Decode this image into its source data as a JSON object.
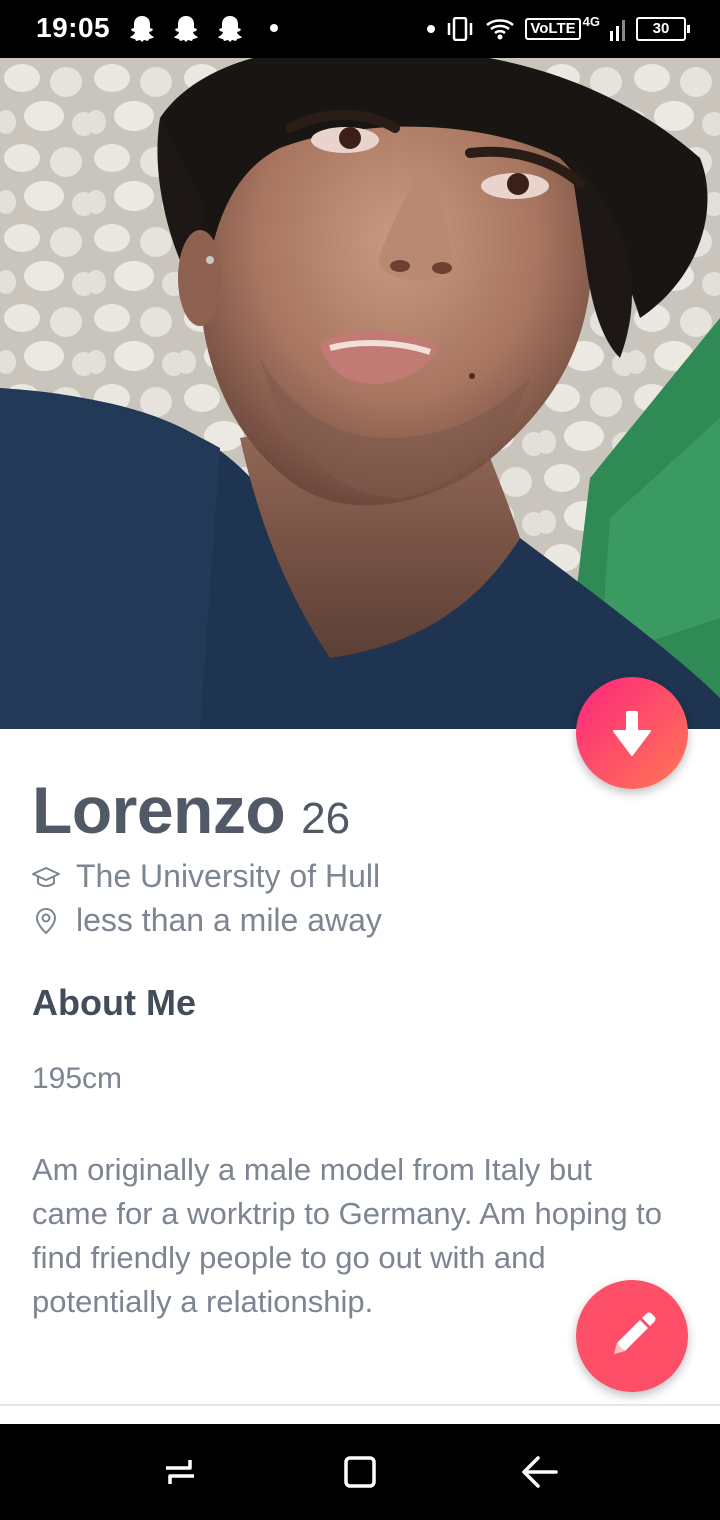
{
  "status_bar": {
    "time": "19:05",
    "volte": "VoLTE",
    "network": "4G",
    "battery": "30",
    "icons": [
      "snapchat-ghost-icon",
      "snapchat-ghost-icon",
      "snapchat-ghost-icon",
      "notification-dot-icon",
      "vibrate-icon",
      "wifi-icon",
      "signal-icon",
      "battery-icon"
    ]
  },
  "profile": {
    "name": "Lorenzo",
    "age": "26",
    "school": "The University of Hull",
    "distance": "less than a mile away",
    "about_title": "About Me",
    "height": "195cm",
    "bio": "Am originally a male model from Italy but came for a worktrip to Germany. Am hoping to find friendly people to go out with and potentially a relationship."
  },
  "actions": {
    "collapse_icon": "arrow-down-icon",
    "edit_icon": "pencil-icon",
    "accent_gradient": [
      "#fd267d",
      "#ff7854"
    ],
    "edit_color": "#fd4f68"
  },
  "nav_bar": {
    "icons": [
      "recent-apps-icon",
      "home-icon",
      "back-icon"
    ]
  }
}
